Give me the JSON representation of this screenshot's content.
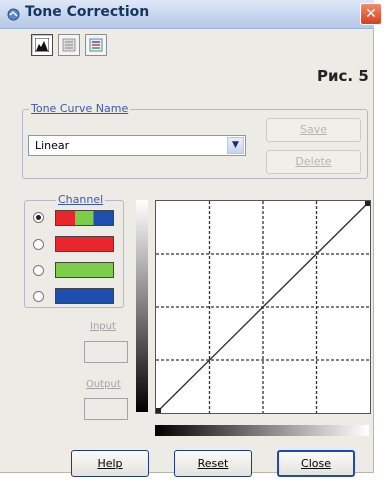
{
  "window": {
    "title": "Tone Correction",
    "close_symbol": "✕"
  },
  "figure_label": "Рис. 5",
  "toolbar": {
    "buttons": [
      {
        "icon": "histogram-icon",
        "active": true
      },
      {
        "icon": "document-icon",
        "active": false
      },
      {
        "icon": "tone-sliders-icon",
        "active": false
      }
    ]
  },
  "tone_curve": {
    "group_label": "Tone Curve Name",
    "selected": "Linear",
    "save_label": "Save",
    "delete_label": "Delete"
  },
  "channel": {
    "group_label": "Channel",
    "options": [
      {
        "name": "RGB",
        "selected": true,
        "colors": [
          "#e8262b",
          "#7dcc4a",
          "#1d4fae"
        ]
      },
      {
        "name": "Red",
        "selected": false,
        "colors": [
          "#e8262b"
        ]
      },
      {
        "name": "Green",
        "selected": false,
        "colors": [
          "#7dcc4a"
        ]
      },
      {
        "name": "Blue",
        "selected": false,
        "colors": [
          "#1d4fae"
        ]
      }
    ]
  },
  "io": {
    "input_label": "Input",
    "output_label": "Output"
  },
  "curve": {
    "points": [
      [
        0,
        0
      ],
      [
        255,
        255
      ]
    ]
  },
  "footer": {
    "help_label": "Help",
    "reset_label": "Reset",
    "close_label": "Close"
  }
}
